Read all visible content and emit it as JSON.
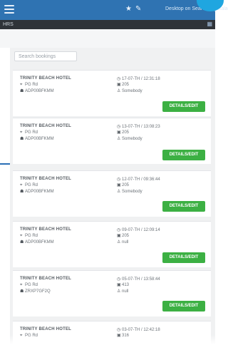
{
  "topbar": {
    "menu_icon": "hamburger-icon",
    "icons": [
      "star-icon",
      "pencil-icon"
    ],
    "text": "Desktop on Search mi_Galagrata"
  },
  "subbar": {
    "label": "HRS",
    "icon": "grid-icon"
  },
  "search": {
    "placeholder": "Search bookings"
  },
  "bookings": [
    {
      "hotel": "TRINITY BEACH HOTEL",
      "location": "PG Rd",
      "ref": "ADP00BFKMM",
      "date": "17-07-TH / 12:31:18",
      "room": "205",
      "guest": "Somebody",
      "button": "DETAILS/EDIT"
    },
    {
      "hotel": "TRINITY BEACH HOTEL",
      "location": "PG Rd",
      "ref": "ADP00BFKMM",
      "date": "13-07-TH / 13:08:23",
      "room": "205",
      "guest": "Somebody",
      "button": "DETAILS/EDIT"
    },
    {
      "hotel": "TRINITY BEACH HOTEL",
      "location": "PG Rd",
      "ref": "ADP00BFKMM",
      "date": "12-07-TH / 09:36:44",
      "room": "205",
      "guest": "Somebody",
      "button": "DETAILS/EDIT"
    },
    {
      "hotel": "TRINITY BEACH HOTEL",
      "location": "PG Rd",
      "ref": "ADP00BFKMM",
      "date": "09-07-TH / 12:09:14",
      "room": "205",
      "guest": "null",
      "button": "DETAILS/EDIT"
    },
    {
      "hotel": "TRINITY BEACH HOTEL",
      "location": "PG Rd",
      "ref": "ZRXP7GF2Q",
      "date": "05-07-TH / 13:58:44",
      "room": "413",
      "guest": "null",
      "button": "DETAILS/EDIT"
    },
    {
      "hotel": "TRINITY BEACH HOTEL",
      "location": "PG Rd",
      "ref": "",
      "date": "03-07-TH / 12:42:18",
      "room": "316",
      "guest": "",
      "button": ""
    }
  ]
}
